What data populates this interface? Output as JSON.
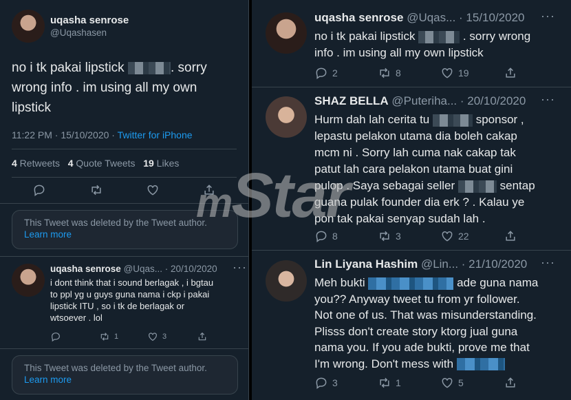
{
  "left": {
    "main_tweet": {
      "name": "uqasha senrose",
      "handle": "@Uqashasen",
      "text_1": "no i tk pakai lipstick",
      "text_2": ". sorry",
      "text_3": "wrong info . im using all my own",
      "text_4": "lipstick",
      "time": "11:22 PM · 15/10/2020 · ",
      "source": "Twitter for iPhone",
      "retweets_count": "4",
      "retweets_label": " Retweets",
      "quotes_count": "4",
      "quotes_label": " Quote Tweets",
      "likes_count": "19",
      "likes_label": " Likes"
    },
    "deleted_notice_1": {
      "text": "This Tweet was deleted by the Tweet author.",
      "link": "Learn more"
    },
    "reply": {
      "name": "uqasha senrose",
      "meta": "@Uqas... · 20/10/2020",
      "lines": [
        "i dont think that i sound berlagak , i bgtau",
        "to ppl yg u guys guna nama i ckp i pakai",
        "lipstick ITU , so i tk de berlagak or",
        "wtsoever . lol"
      ],
      "retweets": "1",
      "likes": "3"
    },
    "deleted_notice_2": {
      "text": "This Tweet was deleted by the Tweet author.",
      "link": "Learn more"
    }
  },
  "right": {
    "tweet1": {
      "name": "uqasha senrose",
      "meta": "@Uqas... · 15/10/2020",
      "line1a": "no i tk pakai lipstick",
      "line1b": ". sorry wrong",
      "line2": "info . im using all my own lipstick",
      "replies": "2",
      "retweets": "8",
      "likes": "19"
    },
    "tweet2": {
      "name": "SHAZ BELLA",
      "meta": "@Puteriha... · 20/10/2020",
      "line1a": "Hurm dah lah cerita tu",
      "line1b": "sponsor ,",
      "line2": "lepastu pelakon utama dia boleh cakap",
      "line3": "mcm ni . Sorry lah cuma nak cakap tak",
      "line4": "patut lah cara pelakon utama buat gini",
      "line5a": "pulop . Saya sebagai seller",
      "line5b": "sentap",
      "line6": "guana pulak founder dia erk ? . Kalau ye",
      "line7": "pon tak pakai senyap sudah lah .",
      "replies": "8",
      "retweets": "3",
      "likes": "22"
    },
    "tweet3": {
      "name": "Lin Liyana Hashim",
      "meta": "@Lin... · 21/10/2020",
      "line1a": "Meh bukti",
      "line1b": "ade guna nama",
      "line2": "you?? Anyway tweet tu from yr follower.",
      "line3": "Not one of us. That was misunderstanding.",
      "line4": "Plisss don't create story ktorg jual guna",
      "line5": "nama you. If you ade bukti, prove me that",
      "line6": "I'm wrong. Don't mess with",
      "replies": "3",
      "retweets": "1",
      "likes": "5"
    }
  },
  "watermark": {
    "prefix": "m",
    "word": "Star"
  }
}
